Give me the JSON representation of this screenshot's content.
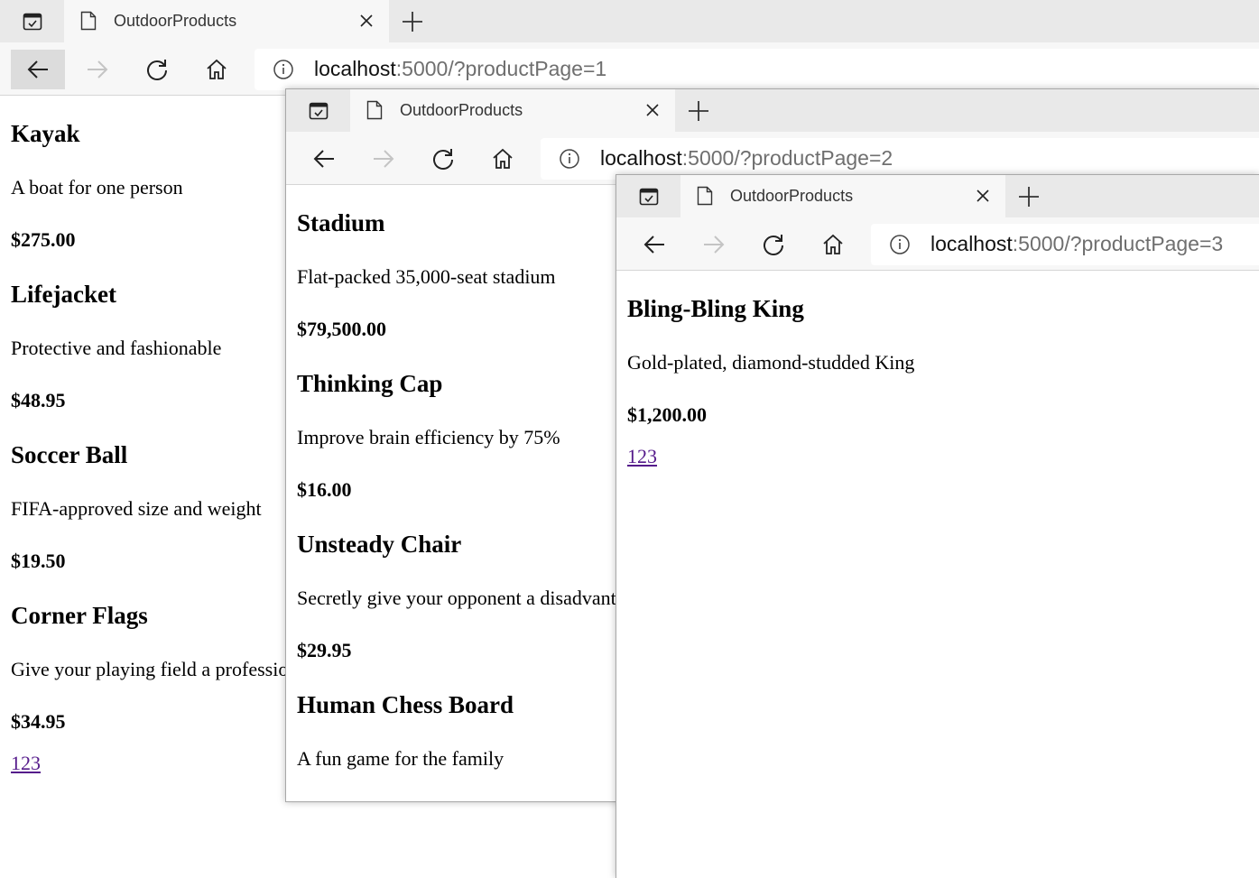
{
  "windows": [
    {
      "tab_title": "OutdoorProducts",
      "url_host": "localhost",
      "url_rest": ":5000/?productPage=1",
      "products": [
        {
          "name": "Kayak",
          "description": "A boat for one person",
          "price": "$275.00"
        },
        {
          "name": "Lifejacket",
          "description": "Protective and fashionable",
          "price": "$48.95"
        },
        {
          "name": "Soccer Ball",
          "description": "FIFA-approved size and weight",
          "price": "$19.50"
        },
        {
          "name": "Corner Flags",
          "description": "Give your playing field a professional touch",
          "price": "$34.95"
        }
      ],
      "pager": "123"
    },
    {
      "tab_title": "OutdoorProducts",
      "url_host": "localhost",
      "url_rest": ":5000/?productPage=2",
      "products": [
        {
          "name": "Stadium",
          "description": "Flat-packed 35,000-seat stadium",
          "price": "$79,500.00"
        },
        {
          "name": "Thinking Cap",
          "description": "Improve brain efficiency by 75%",
          "price": "$16.00"
        },
        {
          "name": "Unsteady Chair",
          "description": "Secretly give your opponent a disadvantage",
          "price": "$29.95"
        },
        {
          "name": "Human Chess Board",
          "description": "A fun game for the family",
          "price": ""
        }
      ]
    },
    {
      "tab_title": "OutdoorProducts",
      "url_host": "localhost",
      "url_rest": ":5000/?productPage=3",
      "products": [
        {
          "name": "Bling-Bling King",
          "description": "Gold-plated, diamond-studded King",
          "price": "$1,200.00"
        }
      ],
      "pager": "123"
    }
  ]
}
